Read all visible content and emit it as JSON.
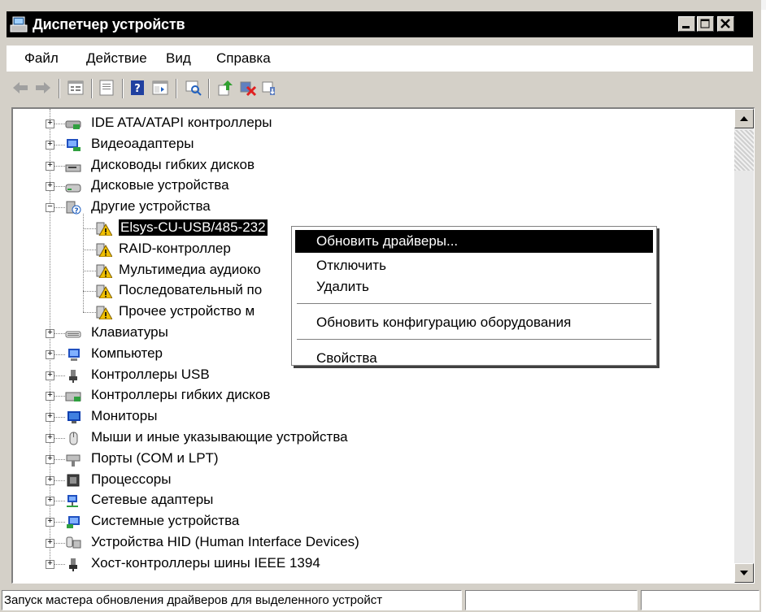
{
  "window": {
    "title": "Диспетчер устройств"
  },
  "menu": [
    "Файл",
    "Действие",
    "Вид",
    "Справка"
  ],
  "toolbar": [
    "back-icon",
    "forward-icon",
    "sep",
    "properties-icon",
    "sep",
    "print-icon",
    "sep",
    "help-icon",
    "show-hide-icon",
    "sep",
    "scan-hardware-icon",
    "sep",
    "update-driver-icon",
    "disable-icon",
    "uninstall-icon"
  ],
  "tree": [
    {
      "label": "IDE ATA/ATAPI контроллеры",
      "icon": "ide-controller-icon",
      "level": 1,
      "exp": "+"
    },
    {
      "label": "Видеоадаптеры",
      "icon": "display-adapter-icon",
      "level": 1,
      "exp": "+"
    },
    {
      "label": "Дисководы гибких дисков",
      "icon": "floppy-drive-icon",
      "level": 1,
      "exp": "+"
    },
    {
      "label": "Дисковые устройства",
      "icon": "disk-drive-icon",
      "level": 1,
      "exp": "+"
    },
    {
      "label": "Другие устройства",
      "icon": "unknown-device-icon",
      "level": 1,
      "exp": "-"
    },
    {
      "label": "Elsys-CU-USB/485-232",
      "icon": "warning-device-icon",
      "level": 2,
      "selected": true
    },
    {
      "label": "RAID-контроллер",
      "icon": "warning-device-icon",
      "level": 2
    },
    {
      "label": "Мультимедиа аудиоко",
      "icon": "warning-device-icon",
      "level": 2
    },
    {
      "label": "Последовательный по",
      "icon": "warning-device-icon",
      "level": 2
    },
    {
      "label": "Прочее устройство м",
      "icon": "warning-device-icon",
      "level": 2
    },
    {
      "label": "Клавиатуры",
      "icon": "keyboard-icon",
      "level": 1,
      "exp": "+"
    },
    {
      "label": "Компьютер",
      "icon": "computer-icon",
      "level": 1,
      "exp": "+"
    },
    {
      "label": "Контроллеры USB",
      "icon": "usb-icon",
      "level": 1,
      "exp": "+"
    },
    {
      "label": "Контроллеры гибких дисков",
      "icon": "floppy-controller-icon",
      "level": 1,
      "exp": "+"
    },
    {
      "label": "Мониторы",
      "icon": "monitor-icon",
      "level": 1,
      "exp": "+"
    },
    {
      "label": "Мыши и иные указывающие устройства",
      "icon": "mouse-icon",
      "level": 1,
      "exp": "+"
    },
    {
      "label": "Порты (COM и LPT)",
      "icon": "port-icon",
      "level": 1,
      "exp": "+"
    },
    {
      "label": "Процессоры",
      "icon": "processor-icon",
      "level": 1,
      "exp": "+"
    },
    {
      "label": "Сетевые адаптеры",
      "icon": "network-adapter-icon",
      "level": 1,
      "exp": "+"
    },
    {
      "label": "Системные устройства",
      "icon": "system-device-icon",
      "level": 1,
      "exp": "+"
    },
    {
      "label": "Устройства HID (Human Interface Devices)",
      "icon": "hid-icon",
      "level": 1,
      "exp": "+"
    },
    {
      "label": "Хост-контроллеры шины IEEE 1394",
      "icon": "ieee1394-icon",
      "level": 1,
      "exp": "+"
    }
  ],
  "context_menu": [
    {
      "label": "Обновить драйверы...",
      "highlighted": true
    },
    {
      "label": "Отключить"
    },
    {
      "label": "Удалить"
    },
    {
      "sep": true
    },
    {
      "label": "Обновить конфигурацию оборудования"
    },
    {
      "sep": true
    },
    {
      "label": "Свойства"
    }
  ],
  "status": {
    "text": "Запуск мастера обновления драйверов для выделенного устройст"
  },
  "colors": {
    "titlebar": "#000000",
    "selection": "#000000",
    "face": "#d4d0c8",
    "warning": "#f0c000"
  }
}
